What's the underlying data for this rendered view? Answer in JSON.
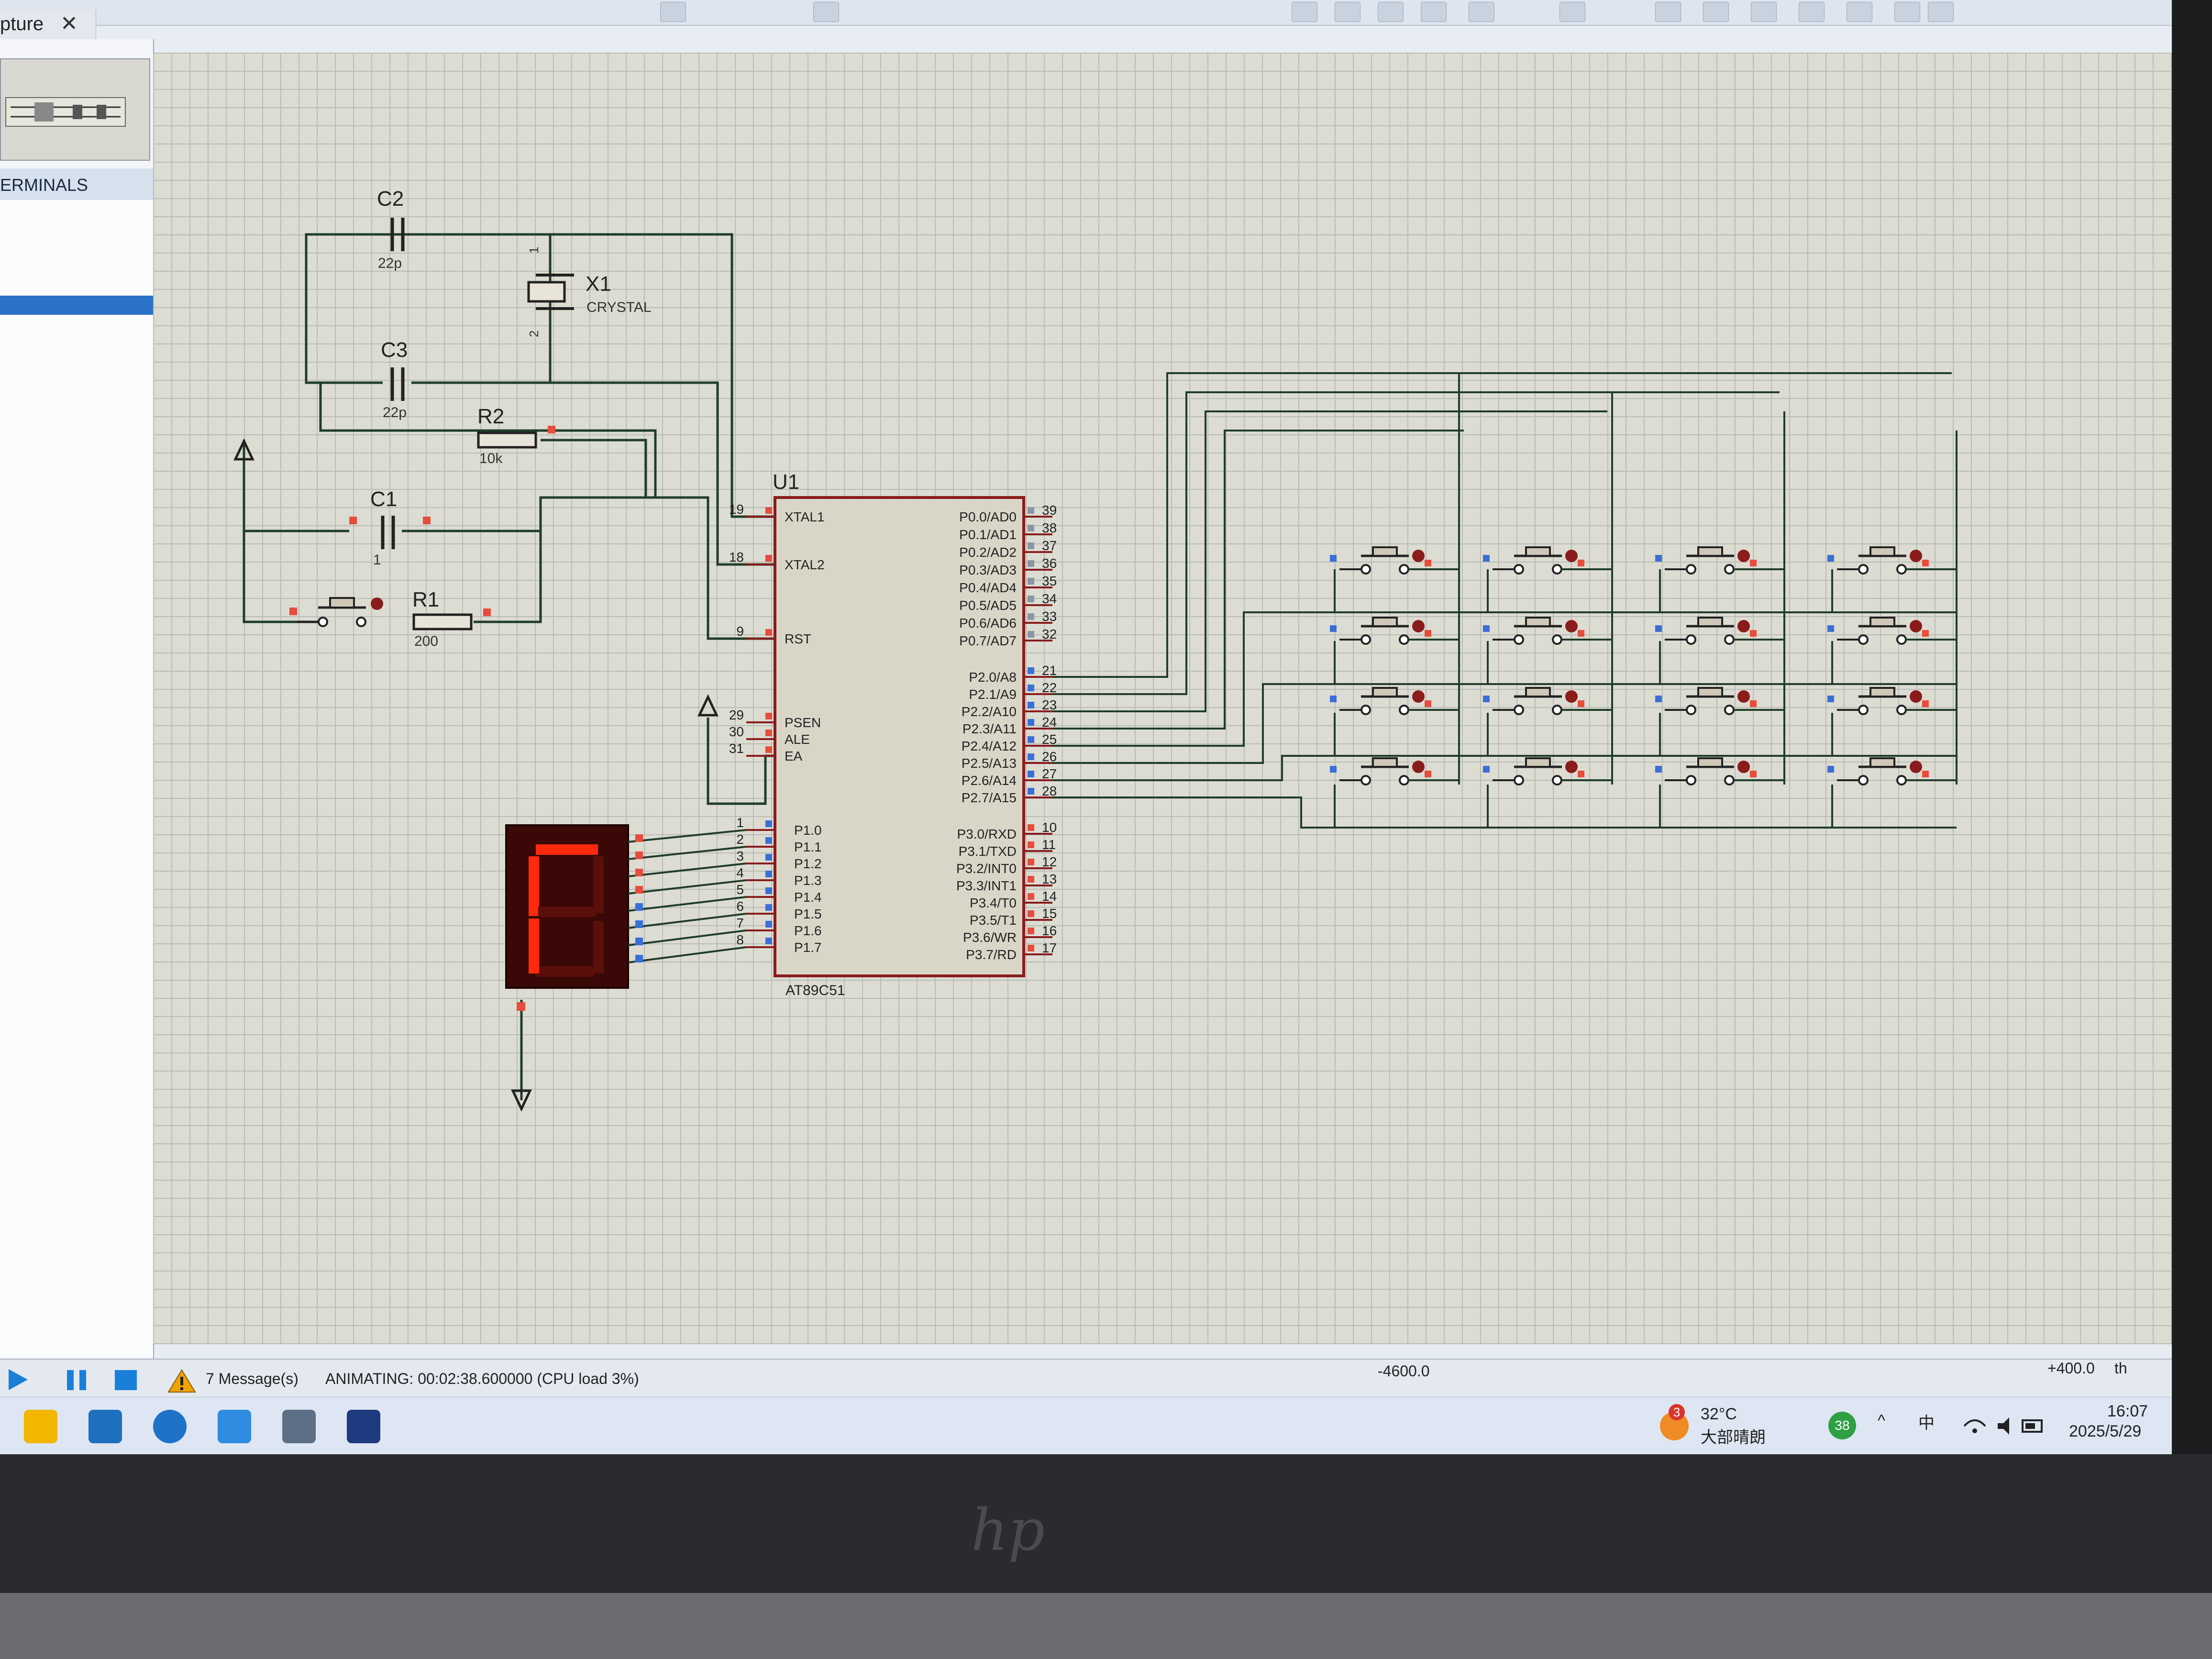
{
  "app": {
    "tab_title": "pture",
    "close_glyph": "✕"
  },
  "left_panel": {
    "terminals_header": "ERMINALS"
  },
  "schematic": {
    "components": {
      "C2": {
        "ref": "C2",
        "value": "22p"
      },
      "C3": {
        "ref": "C3",
        "value": "22p"
      },
      "X1": {
        "ref": "X1",
        "value": "CRYSTAL",
        "pin1": "1",
        "pin2": "2"
      },
      "R2": {
        "ref": "R2",
        "value": "10k"
      },
      "C1": {
        "ref": "C1",
        "value": "1"
      },
      "R1": {
        "ref": "R1",
        "value": "200"
      },
      "U1": {
        "ref": "U1",
        "part": "AT89C51"
      }
    },
    "left_pins": [
      {
        "num": "19",
        "name": "XTAL1"
      },
      {
        "num": "18",
        "name": "XTAL2"
      },
      {
        "num": "9",
        "name": "RST"
      },
      {
        "num": "29",
        "name": "PSEN"
      },
      {
        "num": "30",
        "name": "ALE"
      },
      {
        "num": "31",
        "name": "EA"
      },
      {
        "num": "1",
        "name": "P1.0"
      },
      {
        "num": "2",
        "name": "P1.1"
      },
      {
        "num": "3",
        "name": "P1.2"
      },
      {
        "num": "4",
        "name": "P1.3"
      },
      {
        "num": "5",
        "name": "P1.4"
      },
      {
        "num": "6",
        "name": "P1.5"
      },
      {
        "num": "7",
        "name": "P1.6"
      },
      {
        "num": "8",
        "name": "P1.7"
      }
    ],
    "right_pins": [
      {
        "num": "39",
        "name": "P0.0/AD0"
      },
      {
        "num": "38",
        "name": "P0.1/AD1"
      },
      {
        "num": "37",
        "name": "P0.2/AD2"
      },
      {
        "num": "36",
        "name": "P0.3/AD3"
      },
      {
        "num": "35",
        "name": "P0.4/AD4"
      },
      {
        "num": "34",
        "name": "P0.5/AD5"
      },
      {
        "num": "33",
        "name": "P0.6/AD6"
      },
      {
        "num": "32",
        "name": "P0.7/AD7"
      },
      {
        "num": "21",
        "name": "P2.0/A8"
      },
      {
        "num": "22",
        "name": "P2.1/A9"
      },
      {
        "num": "23",
        "name": "P2.2/A10"
      },
      {
        "num": "24",
        "name": "P2.3/A11"
      },
      {
        "num": "25",
        "name": "P2.4/A12"
      },
      {
        "num": "26",
        "name": "P2.5/A13"
      },
      {
        "num": "27",
        "name": "P2.6/A14"
      },
      {
        "num": "28",
        "name": "P2.7/A15"
      },
      {
        "num": "10",
        "name": "P3.0/RXD"
      },
      {
        "num": "11",
        "name": "P3.1/TXD"
      },
      {
        "num": "12",
        "name": "P3.2/INT0"
      },
      {
        "num": "13",
        "name": "P3.3/INT1"
      },
      {
        "num": "14",
        "name": "P3.4/T0"
      },
      {
        "num": "15",
        "name": "P3.5/T1"
      },
      {
        "num": "16",
        "name": "P3.6/WR"
      },
      {
        "num": "17",
        "name": "P3.7/RD"
      }
    ],
    "keypad": {
      "rows": 4,
      "cols": 4
    },
    "seven_segment": {
      "shown_segments": "a,e,f"
    }
  },
  "status": {
    "messages": "7 Message(s)",
    "animating": "ANIMATING: 00:02:38.600000 (CPU load 3%)",
    "coord_x": "-4600.0",
    "coord_y": "+400.0",
    "coord_unit": "th"
  },
  "taskbar": {
    "weather_badge": "3",
    "temperature": "32°C",
    "weather": "大部晴朗",
    "tray_badge": "38",
    "chevron": "^",
    "ime": "中",
    "time": "16:07",
    "date": "2025/5/29"
  },
  "colors": {
    "canvas_bg": "#dcdcd2",
    "wire": "#1f3d2a",
    "part_outline": "#8a1c1c",
    "chip_fill": "#d9d6c8",
    "segment_on": "#ff2a0e",
    "segment_off": "#5a0f0a",
    "display_body": "#3a0806",
    "status_accent": "#1a7fd8"
  }
}
